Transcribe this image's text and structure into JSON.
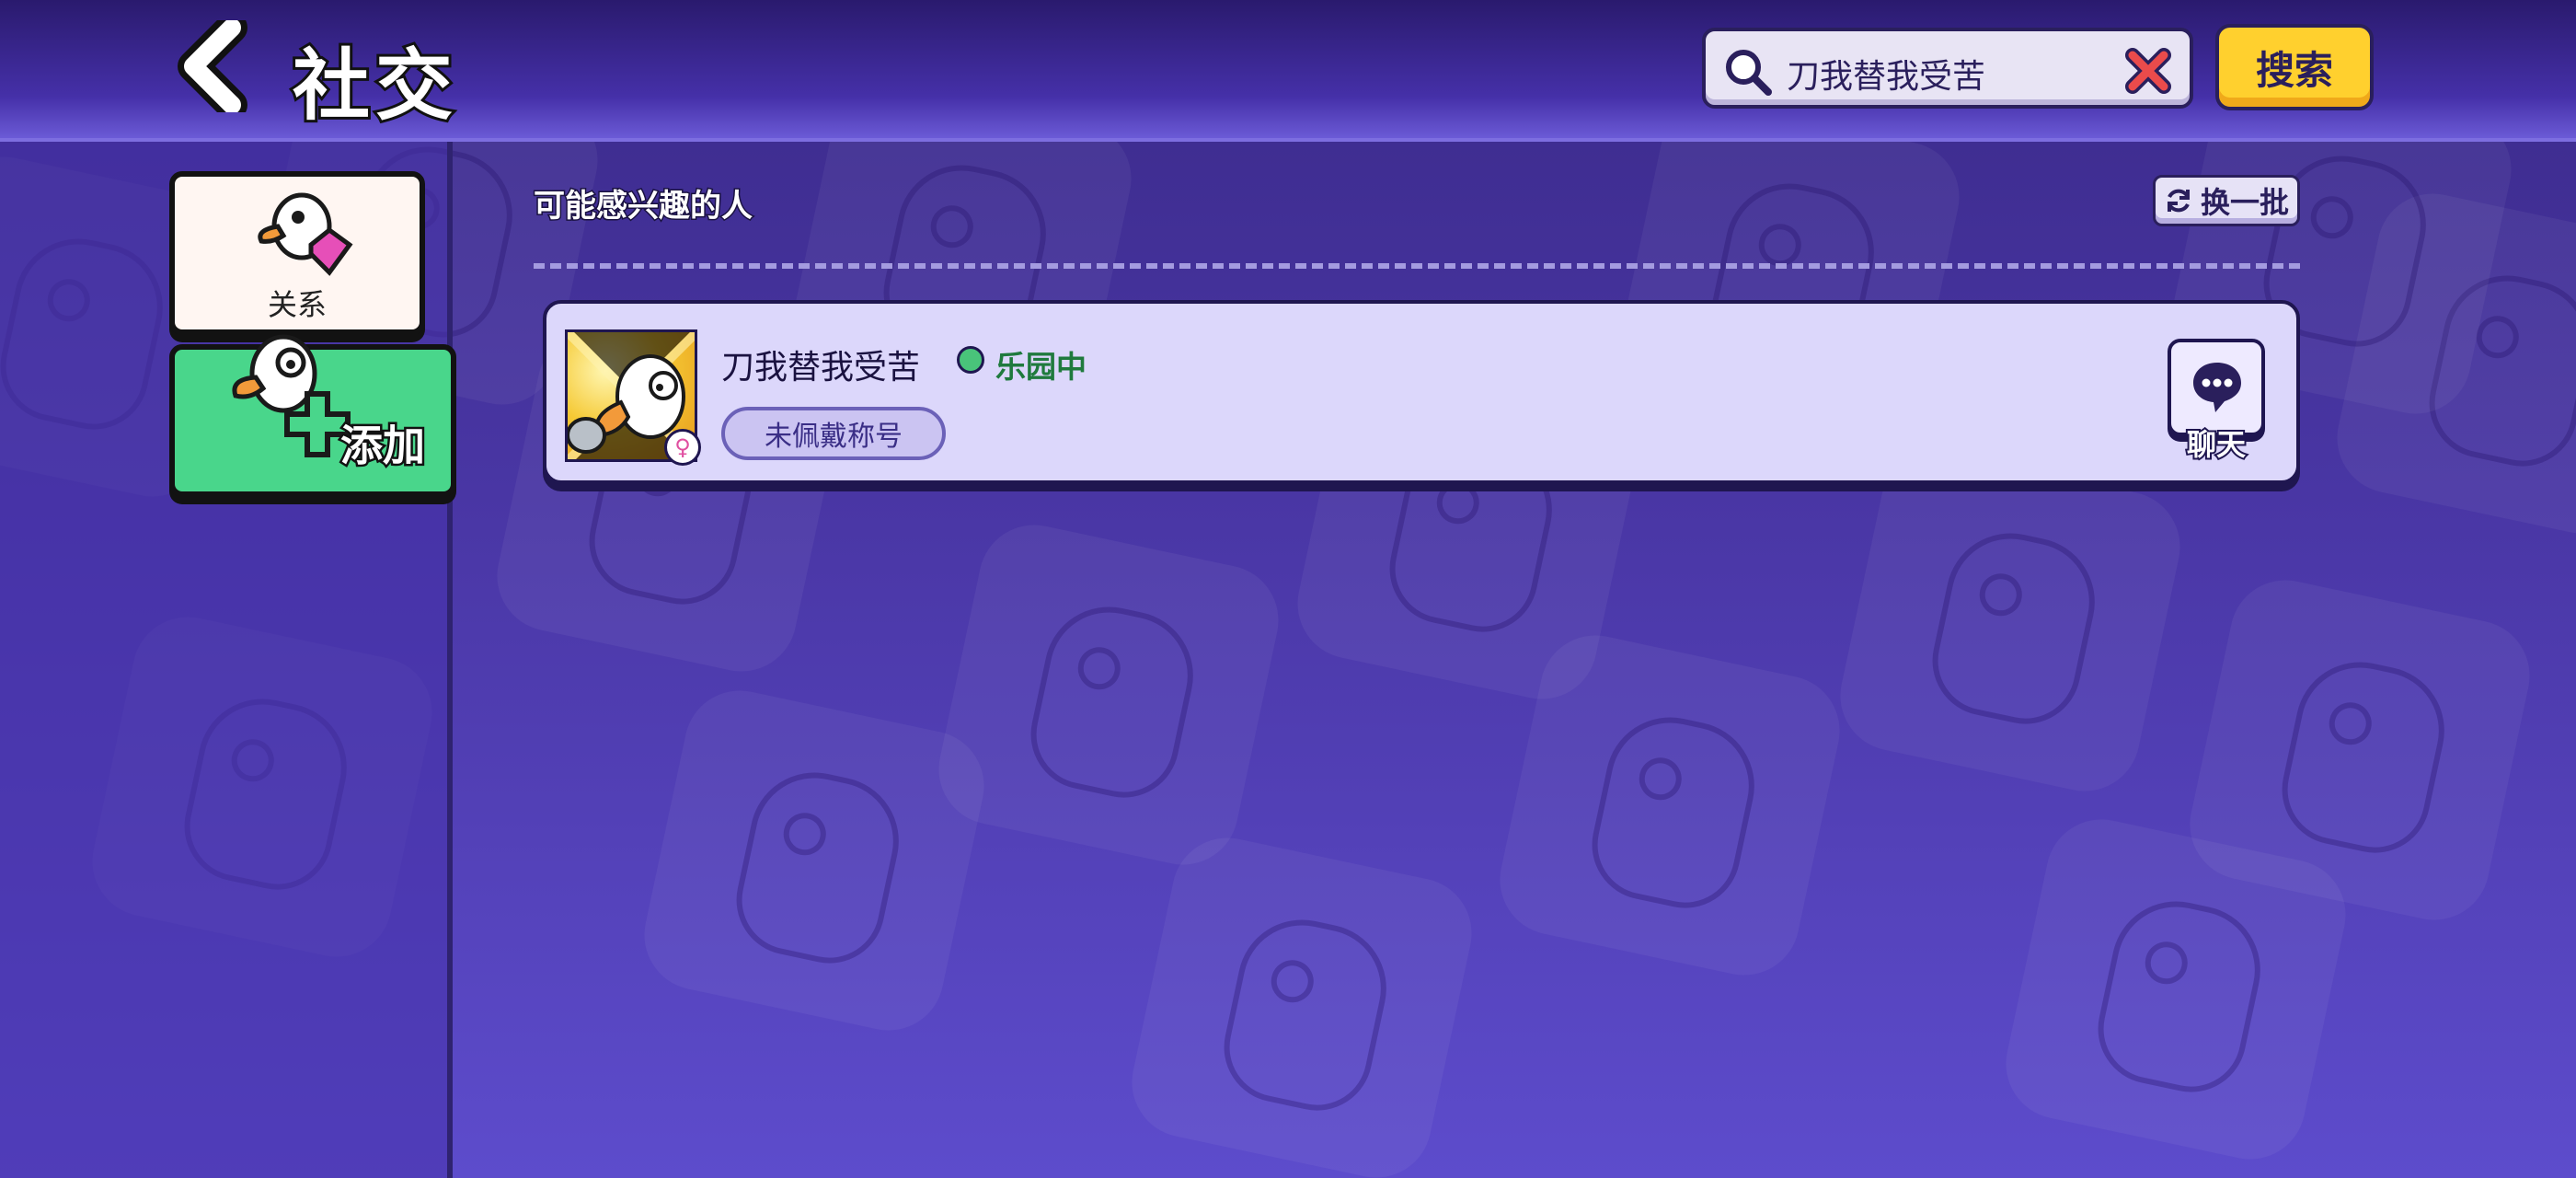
{
  "header": {
    "title": "社交",
    "search_value": "刀我替我受苦",
    "search_button": "搜索"
  },
  "sidebar": {
    "tabs": [
      {
        "label": "关系"
      },
      {
        "label": "添加"
      }
    ]
  },
  "main": {
    "section_title": "可能感兴趣的人",
    "refresh_label": "换一批",
    "players": [
      {
        "name": "刀我替我受苦",
        "status": "乐园中",
        "title_badge": "未佩戴称号",
        "chat_label": "聊天"
      }
    ]
  }
}
